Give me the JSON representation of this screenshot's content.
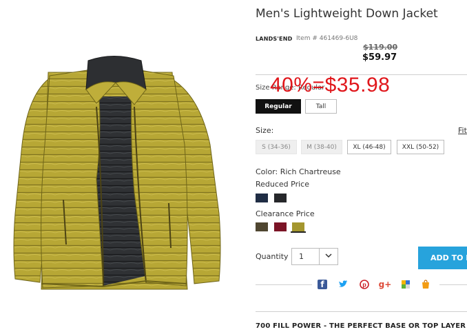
{
  "product": {
    "title": "Men's Lightweight Down Jacket",
    "brand": "LANDS'END",
    "item_number": "Item # 461469-6U8",
    "original_price": "$119.00",
    "sale_price": "$59.97",
    "overlay_text": "40%=$35.98"
  },
  "size_range": {
    "label": "Size Range: Regular",
    "options": [
      "Regular",
      "Tall"
    ],
    "selected": "Regular"
  },
  "size": {
    "label": "Size:",
    "fit_link": "Fit",
    "options": [
      {
        "label": "S (34-36)",
        "available": false
      },
      {
        "label": "M (38-40)",
        "available": false
      },
      {
        "label": "XL (46-48)",
        "available": true
      },
      {
        "label": "XXL (50-52)",
        "available": true
      }
    ]
  },
  "color": {
    "label": "Color: Rich Chartreuse",
    "reduced_label": "Reduced Price",
    "reduced_swatches": [
      "#1f2d44",
      "#26272a"
    ],
    "clearance_label": "Clearance Price",
    "clearance_swatches": [
      "#4f4630",
      "#7b1426",
      "#a4962e"
    ],
    "selected": "Rich Chartreuse"
  },
  "quantity": {
    "label": "Quantity",
    "value": "1"
  },
  "add_button": "ADD TO B",
  "social_icons": [
    "facebook-icon",
    "twitter-icon",
    "pinterest-icon",
    "googleplus-icon",
    "delicious-icon",
    "shopping-bag-icon"
  ],
  "social_colors": [
    "#3b5998",
    "#1da1f2",
    "#cb2027",
    "#dd4b39",
    "#f4b400",
    "#f39c12"
  ],
  "description_heading": "700 FILL POWER - THE PERFECT BASE OR TOP LAYER",
  "colors": {
    "accent": "#27a3dc",
    "overlay": "#e0161b",
    "jacket": "#b4a434"
  }
}
